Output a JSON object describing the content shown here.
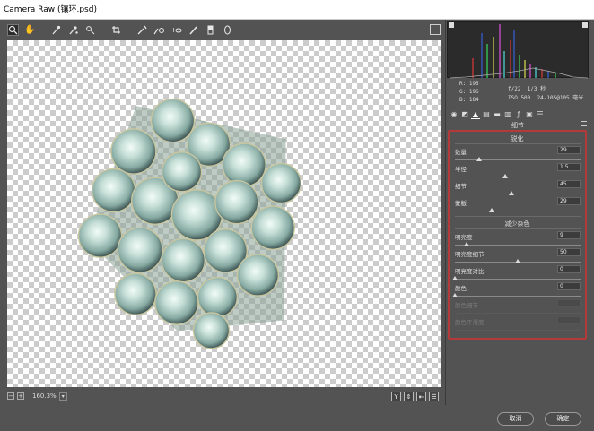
{
  "window": {
    "title": "Camera Raw (镶环.psd)"
  },
  "toolbar": {
    "tools": [
      "zoom-tool",
      "hand-tool",
      "white-balance-tool",
      "color-sampler-tool",
      "targeted-adjustment-tool",
      "crop-tool",
      "straighten-tool",
      "spot-removal-tool",
      "red-eye-tool",
      "adjustment-brush-tool",
      "graduated-filter-tool",
      "radial-filter-tool"
    ]
  },
  "canvas": {
    "background": "transparent-checkerboard"
  },
  "status": {
    "zoom": "160.3%"
  },
  "histogram": {
    "colors": [
      "#ff3b3b",
      "#3b6bff",
      "#3bff6b",
      "#ffff5a",
      "#ff5aff",
      "#5affff"
    ]
  },
  "readout": {
    "r": "R:  195",
    "g": "G:  196",
    "b": "B:  184",
    "aperture": "f/22",
    "shutter": "1/3 秒",
    "iso": "ISO 500",
    "lens": "24-105@105 毫米"
  },
  "panel": {
    "title": "细节",
    "sharpen": {
      "title": "锐化",
      "sliders": [
        {
          "label": "数量",
          "value": "29",
          "pos": 0.19
        },
        {
          "label": "半径",
          "value": "1.5",
          "pos": 0.4
        },
        {
          "label": "细节",
          "value": "45",
          "pos": 0.45
        },
        {
          "label": "蒙版",
          "value": "29",
          "pos": 0.29
        }
      ]
    },
    "noise": {
      "title": "减少杂色",
      "sliders": [
        {
          "label": "明亮度",
          "value": "9",
          "pos": 0.09
        },
        {
          "label": "明亮度细节",
          "value": "50",
          "pos": 0.5
        },
        {
          "label": "明亮度对比",
          "value": "0",
          "pos": 0.0
        },
        {
          "label": "颜色",
          "value": "0",
          "pos": 0.0
        },
        {
          "label": "颜色细节",
          "value": "",
          "pos": 0.0,
          "disabled": true
        },
        {
          "label": "颜色平滑度",
          "value": "",
          "pos": 0.0,
          "disabled": true
        }
      ]
    }
  },
  "buttons": {
    "cancel": "取消",
    "ok": "确定"
  },
  "colors": {
    "highlight": "#b43a3a",
    "background": "#535353"
  }
}
